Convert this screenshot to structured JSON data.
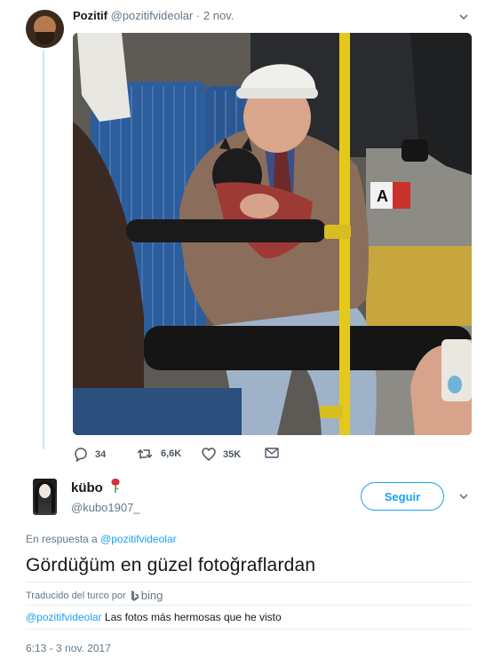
{
  "original_tweet": {
    "author_name": "Pozitif",
    "author_handle": "@pozitifvideolar",
    "separator": "·",
    "date": "2 nov.",
    "actions": {
      "replies": "34",
      "retweets": "6,6K",
      "likes": "35K"
    }
  },
  "reply_tweet": {
    "author_name": "kübo",
    "author_handle": "@kubo1907_",
    "follow_label": "Seguir",
    "in_reply_to_prefix": "En respuesta a",
    "in_reply_to_handle": "@pozitifvideolar",
    "text": "Gördüğüm en güzel fotoğraflardan",
    "translated_label": "Traducido del turco por",
    "translator_name": "bing",
    "translation_mention": "@pozitifvideolar",
    "translation_text": "Las fotos más hermosas que he visto",
    "timestamp": "6:13 - 3 nov. 2017"
  },
  "colors": {
    "accent": "#1da1f2",
    "muted": "#657786",
    "thread_line": "#cde3f5"
  },
  "icons": [
    "chevron-down-icon",
    "reply-icon",
    "retweet-icon",
    "heart-icon",
    "mail-icon",
    "rose-icon",
    "bing-logo-icon"
  ]
}
